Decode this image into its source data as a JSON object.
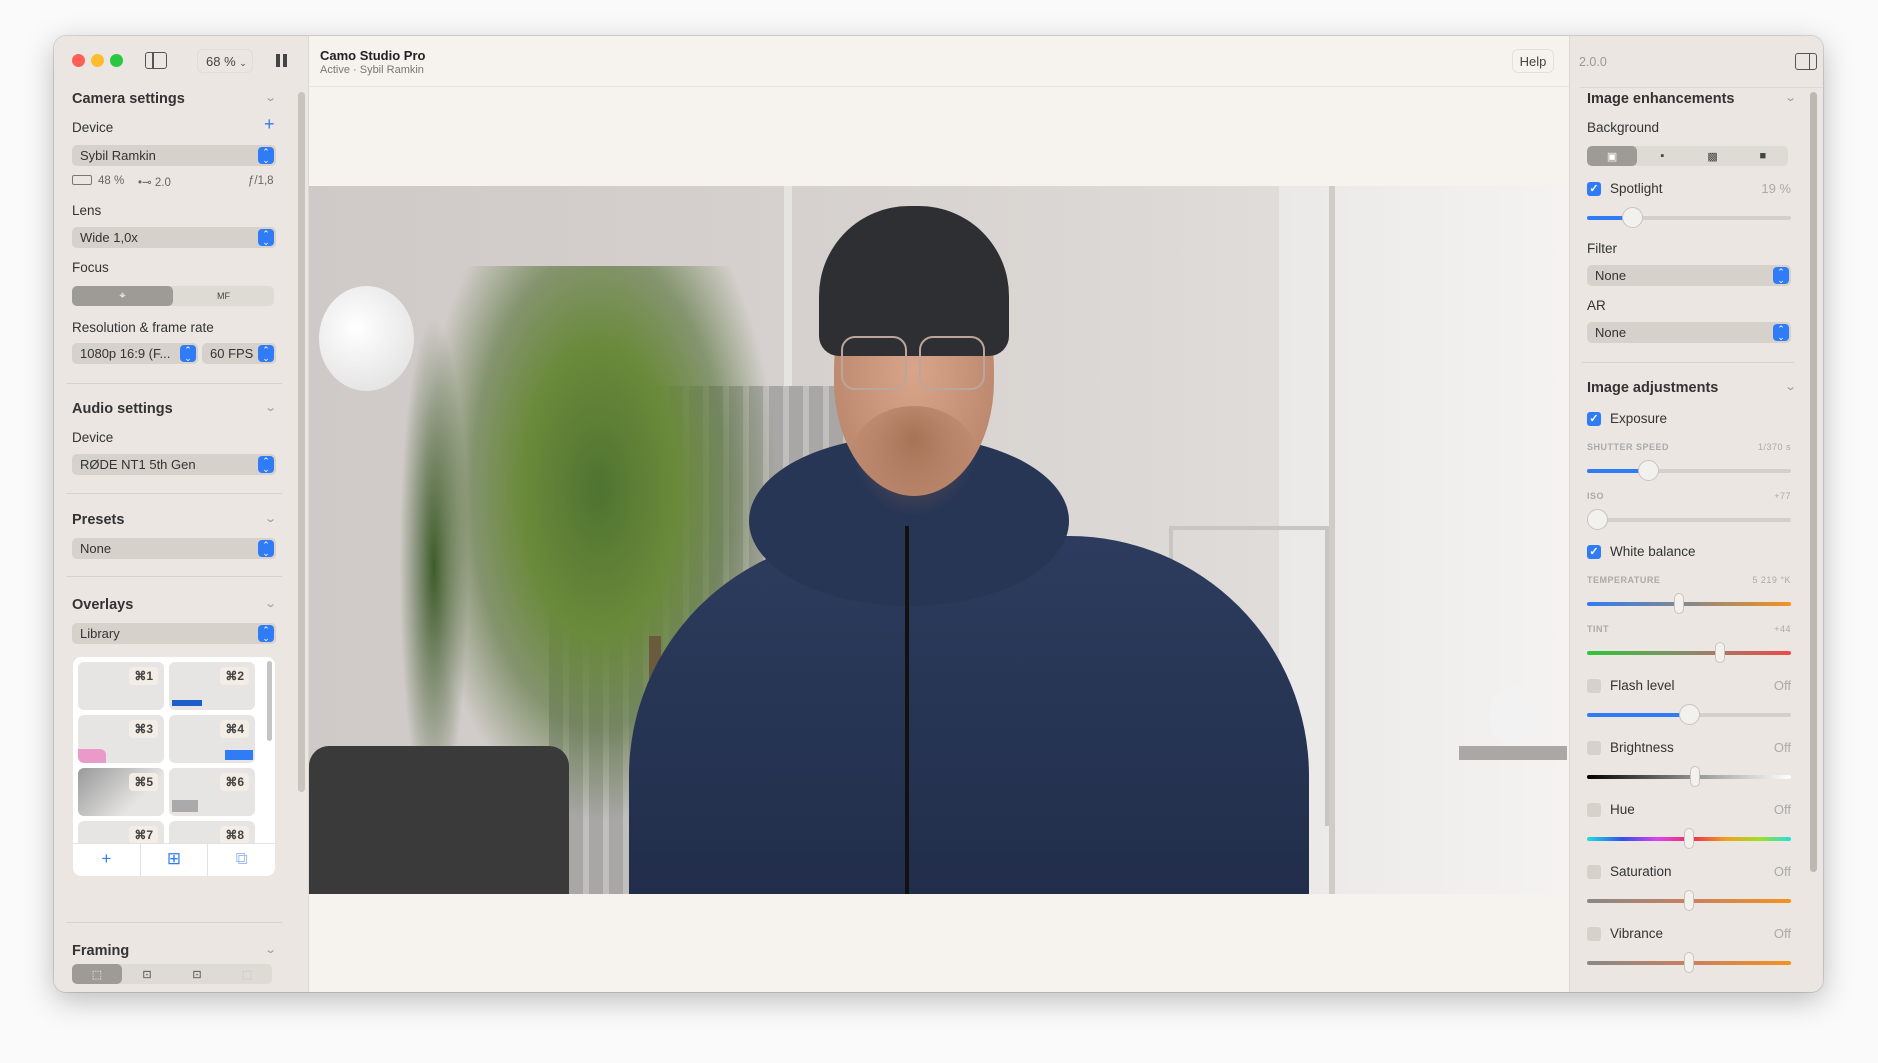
{
  "window": {
    "zoom": "68 %",
    "title": "Camo Studio Pro",
    "subtitle": "Active · Sybil Ramkin",
    "help": "Help",
    "version": "2.0.0"
  },
  "camera": {
    "heading": "Camera settings",
    "device_label": "Device",
    "device": "Sybil Ramkin",
    "battery": "48 %",
    "usb": "2.0",
    "aperture": "ƒ/1,8",
    "lens_label": "Lens",
    "lens": "Wide 1,0x",
    "focus_label": "Focus",
    "focus_modes": [
      "⌖",
      "MF"
    ],
    "focus_selected": 0,
    "res_label": "Resolution & frame rate",
    "resolution": "1080p 16:9 (F...",
    "fps": "60 FPS"
  },
  "audio": {
    "heading": "Audio settings",
    "device_label": "Device",
    "device": "RØDE NT1 5th Gen"
  },
  "presets": {
    "heading": "Presets",
    "value": "None"
  },
  "overlays": {
    "heading": "Overlays",
    "source": "Library",
    "tiles": [
      "⌘1",
      "⌘2",
      "⌘3",
      "⌘4",
      "⌘5",
      "⌘6",
      "⌘7",
      "⌘8"
    ],
    "actions": [
      "+",
      "⊞",
      "⧉"
    ]
  },
  "framing": {
    "heading": "Framing",
    "modes": [
      "⬚",
      "⊡",
      "⊡",
      "⬚"
    ],
    "selected": 0
  },
  "enhancements": {
    "heading": "Image enhancements",
    "background_label": "Background",
    "background_selected": 0,
    "spotlight": {
      "label": "Spotlight",
      "checked": true,
      "value": "19 %",
      "level": 0.22
    },
    "filter_label": "Filter",
    "filter": "None",
    "ar_label": "AR",
    "ar": "None"
  },
  "adjustments": {
    "heading": "Image adjustments",
    "exposure": {
      "label": "Exposure",
      "checked": true
    },
    "shutter": {
      "label": "SHUTTER SPEED",
      "value": "1/370 s",
      "level": 0.3
    },
    "iso": {
      "label": "ISO",
      "value": "+77",
      "level": 0.05
    },
    "white_balance": {
      "label": "White balance",
      "checked": true
    },
    "temperature": {
      "label": "TEMPERATURE",
      "value": "5 219 °K",
      "level": 0.45
    },
    "tint": {
      "label": "TINT",
      "value": "+44",
      "level": 0.65
    },
    "flash": {
      "label": "Flash level",
      "value": "Off",
      "level": 0.5
    },
    "brightness": {
      "label": "Brightness",
      "value": "Off",
      "level": 0.53
    },
    "hue": {
      "label": "Hue",
      "value": "Off",
      "level": 0.5
    },
    "saturation": {
      "label": "Saturation",
      "value": "Off",
      "level": 0.5
    },
    "vibrance": {
      "label": "Vibrance",
      "value": "Off",
      "level": 0.5
    }
  },
  "colors": {
    "accent": "#2f7cf6",
    "close": "#fe5f57",
    "minimize": "#febc2e",
    "zoom": "#28c840"
  }
}
